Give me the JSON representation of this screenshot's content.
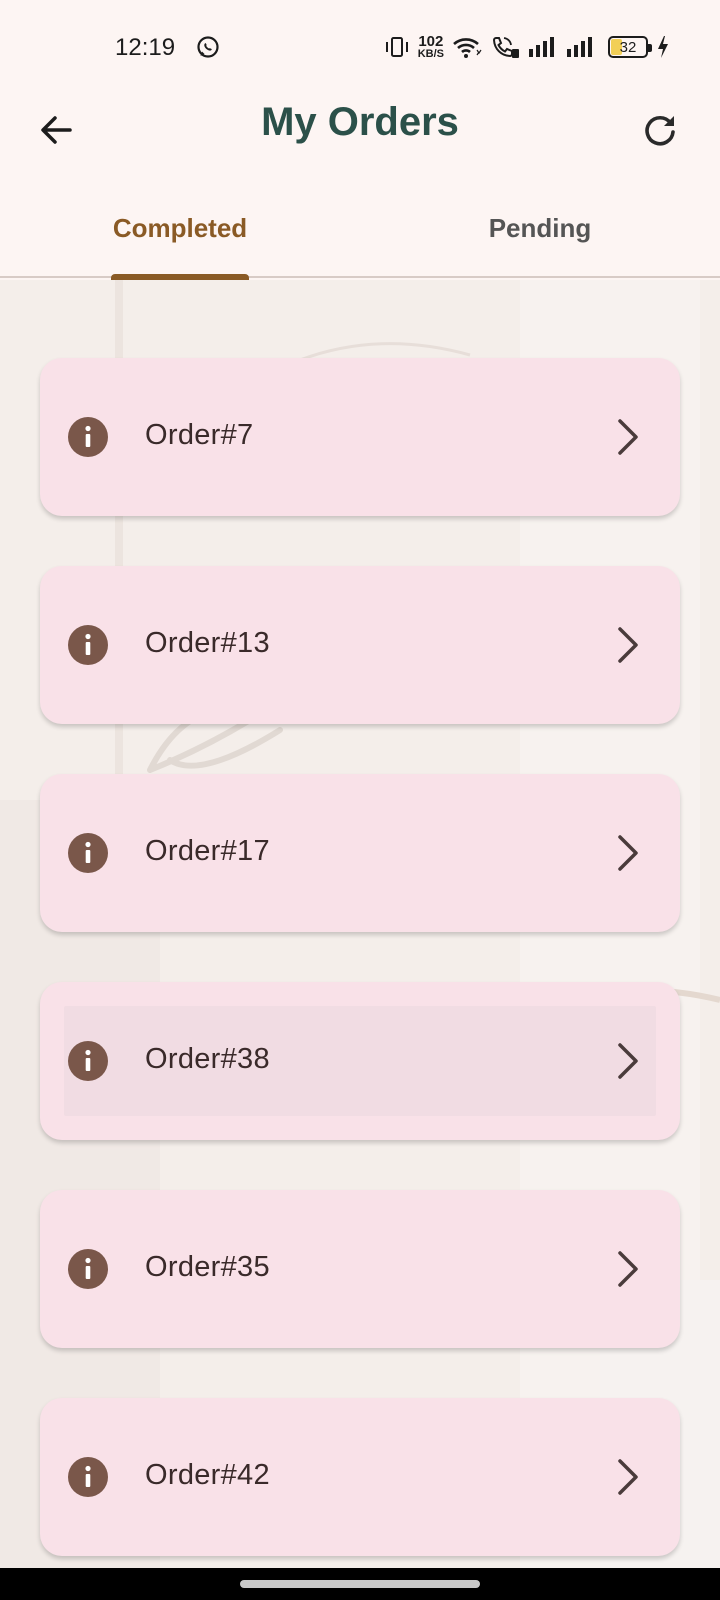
{
  "status_bar": {
    "time": "12:19",
    "net_speed_value": "102",
    "net_speed_unit": "KB/S",
    "battery_level": "32",
    "battery_color": "#f2cf57",
    "icons": [
      "whatsapp-icon",
      "vibrate-icon",
      "wifi-icon",
      "wifi-call-icon",
      "signal-icon",
      "signal-icon",
      "battery-icon",
      "charging-icon"
    ]
  },
  "app_bar": {
    "title": "My Orders",
    "back_icon": "arrow-left-icon",
    "refresh_icon": "refresh-icon"
  },
  "tabs": [
    {
      "label": "Completed",
      "selected": true
    },
    {
      "label": "Pending",
      "selected": false
    }
  ],
  "orders": [
    {
      "label": "Order#7"
    },
    {
      "label": "Order#13"
    },
    {
      "label": "Order#17"
    },
    {
      "label": "Order#38"
    },
    {
      "label": "Order#35"
    },
    {
      "label": "Order#42"
    }
  ],
  "colors": {
    "background": "#fdf5f3",
    "title": "#2b5049",
    "accent": "#8a5a25",
    "card": "#f9e1e8",
    "info_icon": "#7a574a",
    "chevron": "#4a3b3b"
  }
}
